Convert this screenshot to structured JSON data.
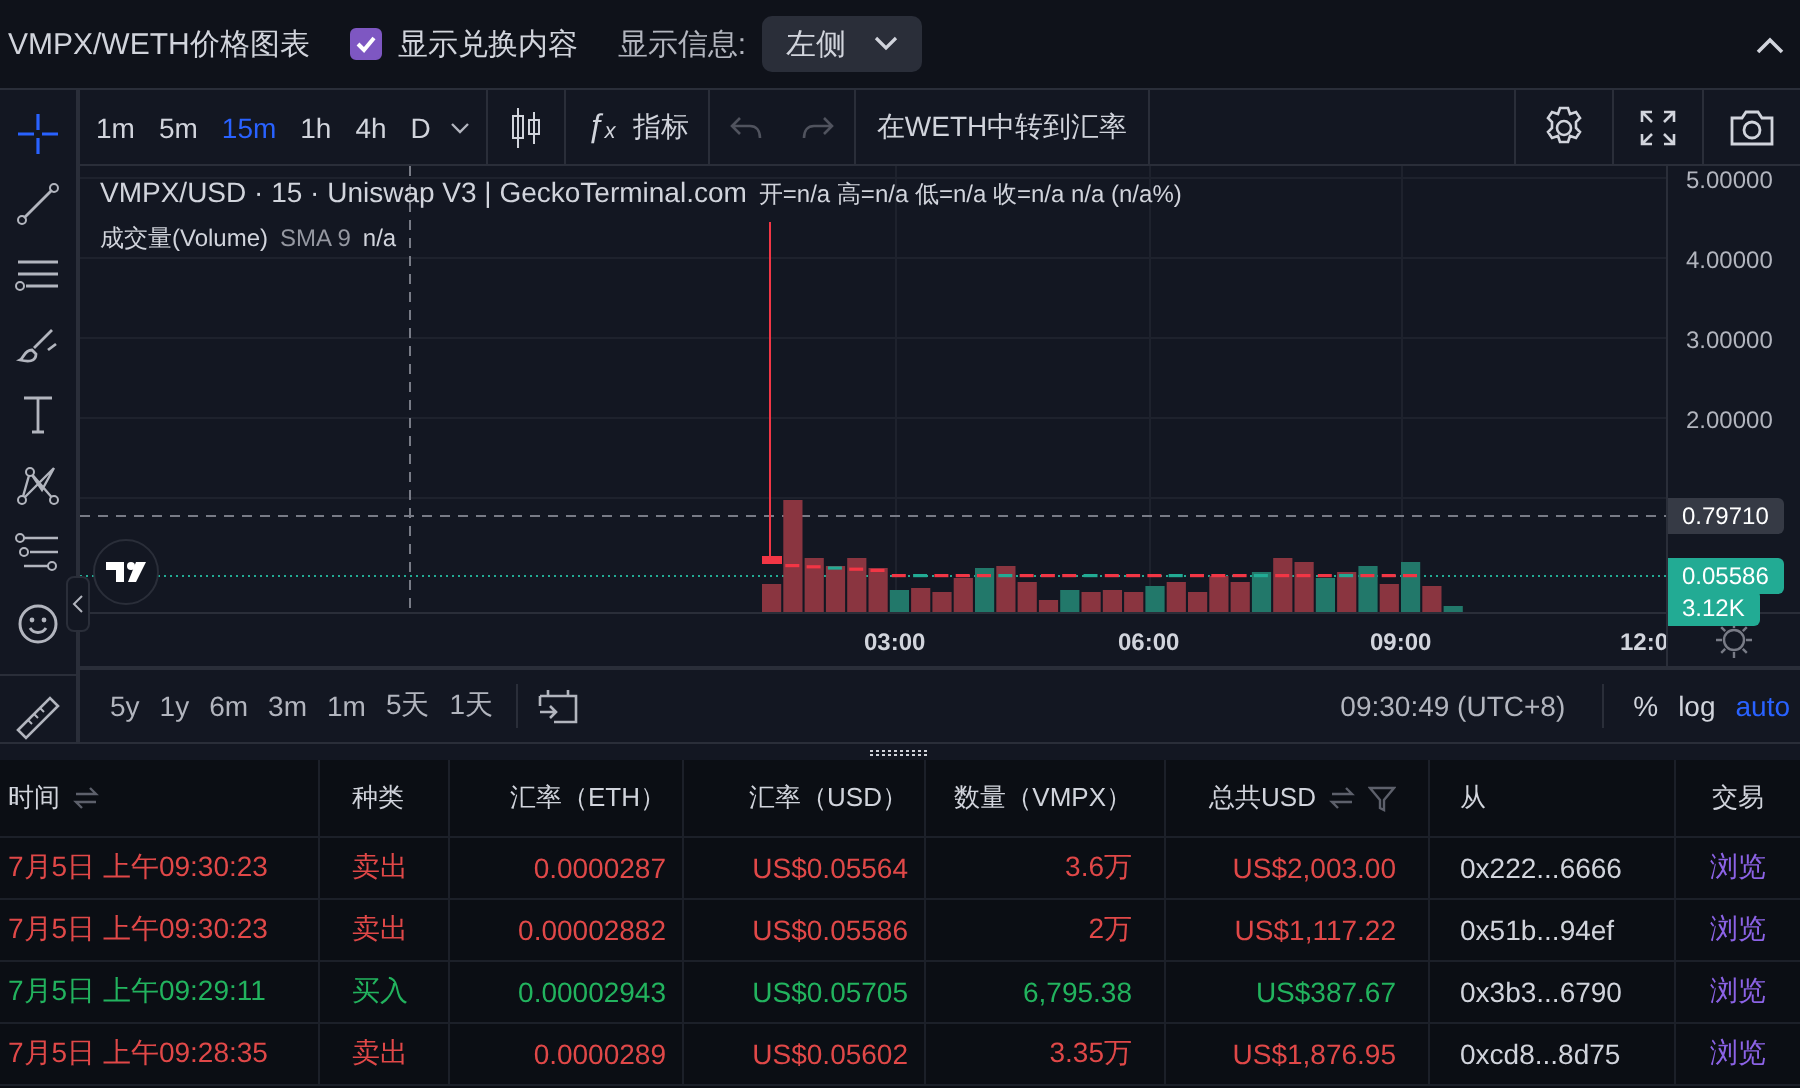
{
  "header": {
    "title": "VMPX/WETH价格图表",
    "show_swaps": {
      "label": "显示兑换内容",
      "checked": true
    },
    "info": {
      "label": "显示信息:",
      "value": "左侧"
    }
  },
  "chart": {
    "intervals": [
      {
        "label": "1m",
        "selected": false
      },
      {
        "label": "5m",
        "selected": false
      },
      {
        "label": "15m",
        "selected": true
      },
      {
        "label": "1h",
        "selected": false
      },
      {
        "label": "4h",
        "selected": false
      },
      {
        "label": "D",
        "selected": false
      }
    ],
    "indicators_icon": "ƒₓ",
    "indicators": "指标",
    "convert": "在WETH中转到汇率",
    "legend": {
      "symbol": "VMPX/USD · 15 · Uniswap V3 | GeckoTerminal.com",
      "ohlc": "开=n/a 高=n/a 低=n/a 收=n/a n/a (n/a%)",
      "volume_name": "成交量(Volume)",
      "volume_sma": "SMA 9",
      "volume_value": "n/a"
    },
    "price_ticks": [
      "5.00000",
      "4.00000",
      "3.00000",
      "2.00000"
    ],
    "price_tags": [
      {
        "label": "0.79710",
        "kind": "crosshair"
      },
      {
        "label": "0.05586",
        "kind": "last"
      },
      {
        "label": "3.12K",
        "kind": "volume"
      }
    ],
    "time_ticks": [
      "03:00",
      "06:00",
      "09:00",
      "12:0"
    ],
    "ranges": [
      "5y",
      "1y",
      "6m",
      "3m",
      "1m",
      "5天",
      "1天"
    ],
    "clock": "09:30:49 (UTC+8)",
    "scale_options": [
      {
        "label": "%",
        "selected": false
      },
      {
        "label": "log",
        "selected": false
      },
      {
        "label": "auto",
        "selected": true
      }
    ]
  },
  "table": {
    "columns": [
      {
        "label": "时间",
        "sortable": true,
        "filterable": false
      },
      {
        "label": "种类",
        "sortable": false,
        "filterable": false
      },
      {
        "label": "汇率（ETH）",
        "sortable": false,
        "filterable": false
      },
      {
        "label": "汇率（USD）",
        "sortable": false,
        "filterable": false
      },
      {
        "label": "数量（VMPX）",
        "sortable": false,
        "filterable": false
      },
      {
        "label": "总共USD",
        "sortable": true,
        "filterable": true
      },
      {
        "label": "从",
        "sortable": false,
        "filterable": false
      },
      {
        "label": "交易",
        "sortable": false,
        "filterable": false
      }
    ],
    "rows": [
      {
        "buy": false,
        "cells": [
          "7月5日 上午09:30:23",
          "卖出",
          "0.0000287",
          "US$0.05564",
          "3.6万",
          "US$2,003.00",
          "0x222...6666",
          "浏览"
        ]
      },
      {
        "buy": false,
        "cells": [
          "7月5日 上午09:30:23",
          "卖出",
          "0.00002882",
          "US$0.05586",
          "2万",
          "US$1,117.22",
          "0x51b...94ef",
          "浏览"
        ]
      },
      {
        "buy": true,
        "cells": [
          "7月5日 上午09:29:11",
          "买入",
          "0.00002943",
          "US$0.05705",
          "6,795.38",
          "US$387.67",
          "0x3b3...6790",
          "浏览"
        ]
      },
      {
        "buy": false,
        "cells": [
          "7月5日 上午09:28:35",
          "卖出",
          "0.0000289",
          "US$0.05602",
          "3.35万",
          "US$1,876.95",
          "0xcd8...8d75",
          "浏览"
        ]
      }
    ]
  }
}
